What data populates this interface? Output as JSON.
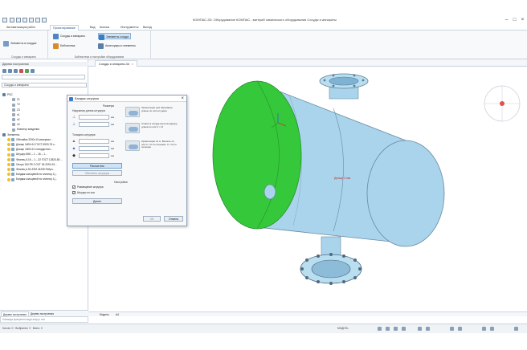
{
  "window": {
    "title": "КОМПАС-3D: Оборудование КОМПАС - ватерий химического оборудования Сосуды и аппараты",
    "controls": [
      "–",
      "□",
      "×"
    ]
  },
  "ribbon": {
    "tabs": [
      "Автоматизация работ",
      "Проектирование",
      "Вид",
      "Анализ",
      "Инструменты",
      "Выход"
    ],
    "active_tab_index": 1,
    "groups": [
      {
        "label": "Сосуды и аппараты",
        "buttons": [
          "Элементы в сосудах"
        ]
      },
      {
        "label": "Библиотека и настройки оборудования",
        "buttons": [
          "Сосуды и аппараты",
          "Библиотека",
          "Элементы сосуда",
          "Аксессуары и элементы"
        ]
      }
    ]
  },
  "left_panel": {
    "title": "Дерево построения",
    "combo_value": "Сосуды и аппараты",
    "tree": [
      {
        "label": "РОС",
        "level": 0
      },
      {
        "label": "Z1",
        "level": 2
      },
      {
        "label": "Y2",
        "level": 2
      },
      {
        "label": "Z3",
        "level": 2
      },
      {
        "label": "n1",
        "level": 2
      },
      {
        "label": "n2",
        "level": 2
      },
      {
        "label": "n3",
        "level": 2
      },
      {
        "label": "Монитор владения",
        "level": 2
      },
      {
        "label": "Элементы",
        "level": 0
      },
      {
        "label": "Обечайка 3200×10 материал...",
        "level": 1
      },
      {
        "label": "Днище 1600×10 ГОСТ 6533-78 с...",
        "level": 1
      },
      {
        "label": "Днище 1600×10 стандартное...",
        "level": 1
      },
      {
        "label": "Штуцер Ø40 – 1 – 16 – 1...",
        "level": 1
      },
      {
        "label": "Фланец 6-16 – 1 – 32 ГОСТ 12820-80 ...",
        "level": 1
      },
      {
        "label": "Опора 160 FB 3 ОСТ 26-2091-93...",
        "level": 1
      },
      {
        "label": "Фланец 6-50 ATM 24208 Ребро...",
        "level": 1
      },
      {
        "label": "Бандаж кольцевой по эллипсу 1(...",
        "level": 1
      },
      {
        "label": "Бандаж кольцевой по эллипсу 1(...",
        "level": 1
      }
    ],
    "bottom_tabs": [
      "Дерево построения",
      "Дерево построения"
    ]
  },
  "document": {
    "tab_label": "Сосуды и аппараты.3d",
    "bottom_tabs": [
      "Модель",
      "A4"
    ]
  },
  "dialog": {
    "title": "Бандаж штуцера",
    "section_length": "Размеры",
    "label_length": "Наружная длина штуцера",
    "unit_mm": "мм",
    "section_thickness": "Толщина штуцера",
    "options": [
      "Ориентация для обрезания длины по оси штуцера",
      "Ставит в сосуде вылета наружу, длина по оси C × D",
      "Ориентация по С, Вылеты по оси C × D по сечению. С × D по сечению"
    ],
    "rows_dims": [
      "мм",
      "мм",
      "мм",
      "мм",
      "мм"
    ],
    "btn_calc": "Рассчитать",
    "btn_calc2": "Обновить штуцеры",
    "section_extra": "Настройки",
    "chk1": "Размещение штуцера",
    "chk2": "Штуцер по оси",
    "btn_extra": "Далее",
    "btn_ok": "ОК",
    "btn_cancel": "Отмена"
  },
  "viewport": {
    "vessel_color": "#a9d4ec",
    "highlight_color": "#35c83a",
    "label_on_vessel": "Днище 0 мм"
  },
  "command_line": "Команда вращения вида вокруг оси",
  "status": {
    "left": "Кол-во: 0 · Выбранно: 0 · Всего: 0",
    "mid": "МОДЕЛЬ"
  }
}
